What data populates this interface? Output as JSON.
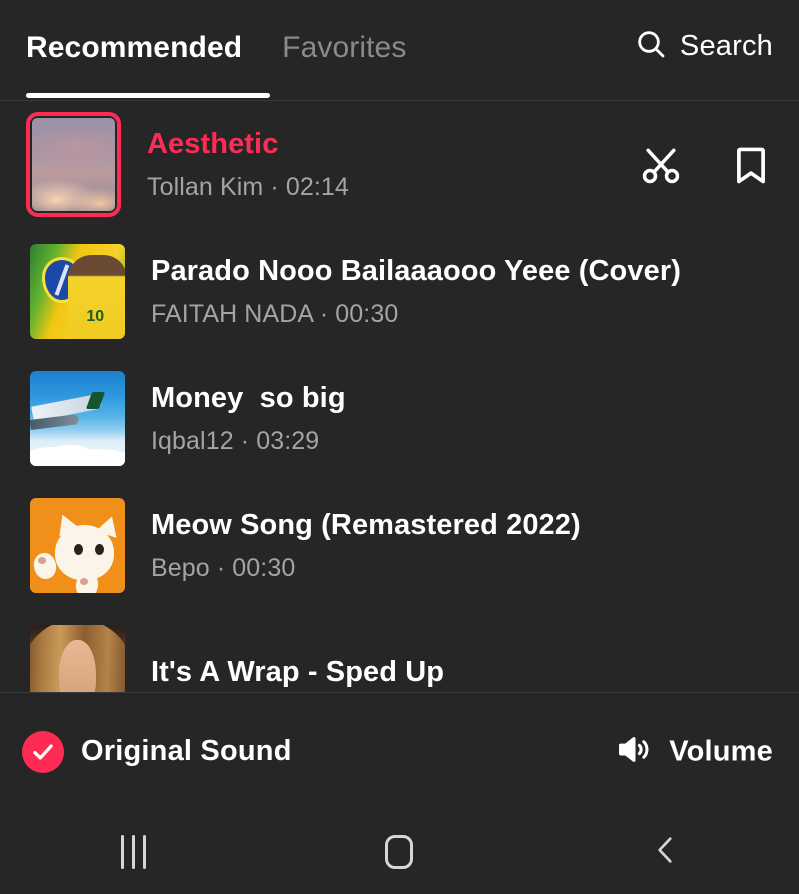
{
  "app": {
    "theme_bg": "#262626",
    "accent": "#FE2C55"
  },
  "header": {
    "tabs": [
      {
        "label": "Recommended",
        "active": true
      },
      {
        "label": "Favorites",
        "active": false
      }
    ],
    "search": {
      "label": "Search",
      "icon": "search-icon"
    }
  },
  "sounds": [
    {
      "title": "Aesthetic",
      "artist": "Tollan Kim",
      "duration": "02:14",
      "subtitle": "Tollan Kim · 02:14",
      "selected": true,
      "art": "sunset-sky",
      "actions": [
        {
          "name": "trim-sound-button",
          "icon": "scissors-icon"
        },
        {
          "name": "bookmark-sound-button",
          "icon": "bookmark-icon"
        }
      ]
    },
    {
      "title": "Parado Nooo Bailaaaooo Yeee (Cover)",
      "artist": "FAITAH NADA",
      "duration": "00:30",
      "subtitle": "FAITAH NADA · 00:30",
      "selected": false,
      "art": "brazil-footballer"
    },
    {
      "title": "Money  so big",
      "artist": "Iqbal12",
      "duration": "03:29",
      "subtitle": "Iqbal12 · 03:29",
      "selected": false,
      "art": "airplane-wing-sky"
    },
    {
      "title": "Meow Song (Remastered 2022)",
      "artist": "Bepo",
      "duration": "00:30",
      "subtitle": "Bepo · 00:30",
      "selected": false,
      "art": "orange-cat"
    },
    {
      "title": "It's A Wrap - Sped Up",
      "artist": "",
      "duration": "",
      "subtitle": "",
      "selected": false,
      "art": "singer-portrait"
    }
  ],
  "bottom_bar": {
    "original_sound": {
      "label": "Original Sound",
      "checked": true,
      "icon": "check-circle-icon"
    },
    "volume": {
      "label": "Volume",
      "icon": "speaker-icon"
    }
  },
  "nav_bar": {
    "recents_label": "recents-icon",
    "home_label": "home-icon",
    "back_label": "back-icon"
  }
}
